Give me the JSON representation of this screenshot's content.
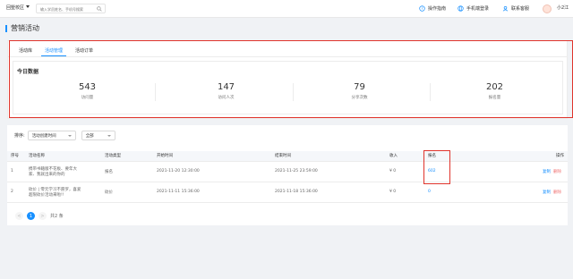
{
  "topbar": {
    "campus": "回墅校区",
    "search_placeholder": "输入学员姓名、手机号搜索",
    "items": [
      {
        "label": "操作指南",
        "icon": "guide-icon"
      },
      {
        "label": "手机端登录",
        "icon": "phone-icon"
      },
      {
        "label": "联系客服",
        "icon": "service-icon"
      }
    ],
    "user": "小2江"
  },
  "page": {
    "title": "营销活动"
  },
  "tabs": [
    "活动库",
    "活动管理",
    "活动订单"
  ],
  "active_tab": "活动管理",
  "today": {
    "title": "今日数据",
    "stats": [
      {
        "value": "543",
        "label": "访问量"
      },
      {
        "value": "147",
        "label": "访问人次"
      },
      {
        "value": "79",
        "label": "分享次数"
      },
      {
        "value": "202",
        "label": "报名量"
      }
    ]
  },
  "filters": {
    "sort_label": "排序:",
    "sort_value": "活动创建时间",
    "status_value": "全部"
  },
  "table": {
    "headers": [
      "序号",
      "活动名称",
      "活动类型",
      "开始时间",
      "结束时间",
      "收入",
      "报名",
      "操作"
    ],
    "rows": [
      {
        "index": "1",
        "name_line1": "携带书籍版不花板、要年大",
        "name_line2": "家、我就出来的你的",
        "type": "报名",
        "start": "2021-11-20 12:30:00",
        "end": "2021-11-25 23:59:00",
        "income": "¥ 0",
        "signups": "602",
        "op_edit": "复制",
        "op_del": "删除"
      },
      {
        "index": "2",
        "name_line1": "砍价 | 零元学习不愿罗，喜爱",
        "name_line2": "超限砍价活动来啦!!",
        "type": "砍价",
        "start": "2021-11-11 15:36:00",
        "end": "2021-11-18 15:36:00",
        "income": "¥ 0",
        "signups": "0",
        "op_edit": "复制",
        "op_del": "删除"
      }
    ]
  },
  "pagination": {
    "prev": "<",
    "current": "1",
    "next": ">",
    "total": "共2 条"
  },
  "colors": {
    "accent": "#1890ff",
    "highlight_border": "#e0342c",
    "delete": "#f07070"
  }
}
